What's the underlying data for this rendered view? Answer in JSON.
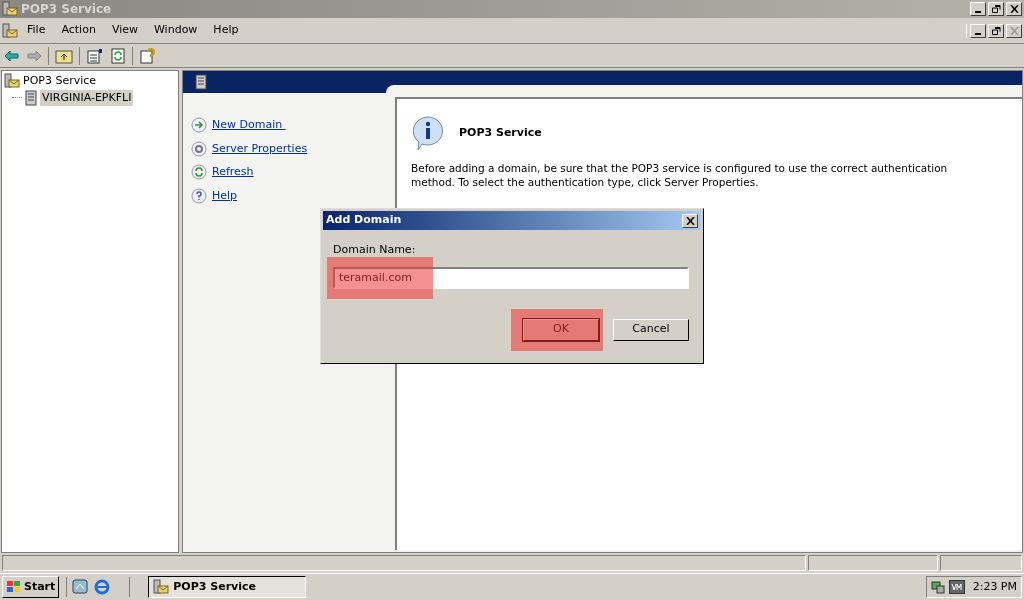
{
  "window": {
    "title": "POP3 Service"
  },
  "menu": [
    "File",
    "Action",
    "View",
    "Window",
    "Help"
  ],
  "tree": {
    "label": "POP3 Service",
    "children": [
      {
        "label": "VIRGINIA-EPKFLI",
        "selected": true
      }
    ]
  },
  "tasks": [
    {
      "label": "New Domain ",
      "kind": "new"
    },
    {
      "label": "Server Properties",
      "kind": "properties"
    },
    {
      "label": "Refresh",
      "kind": "refresh"
    },
    {
      "label": "Help",
      "kind": "help"
    }
  ],
  "info": {
    "title": "POP3 Service",
    "text": "Before adding a domain, be sure that the POP3 service is configured to use the correct authentication method. To select the authentication type, click Server Properties."
  },
  "dialog": {
    "title": "Add Domain",
    "label": "Domain Name:",
    "value": "teramail.com",
    "buttons": [
      "OK",
      "Cancel"
    ]
  },
  "taskbar": {
    "start": "Start",
    "task": "POP3 Service",
    "clock": "2:23 PM"
  }
}
